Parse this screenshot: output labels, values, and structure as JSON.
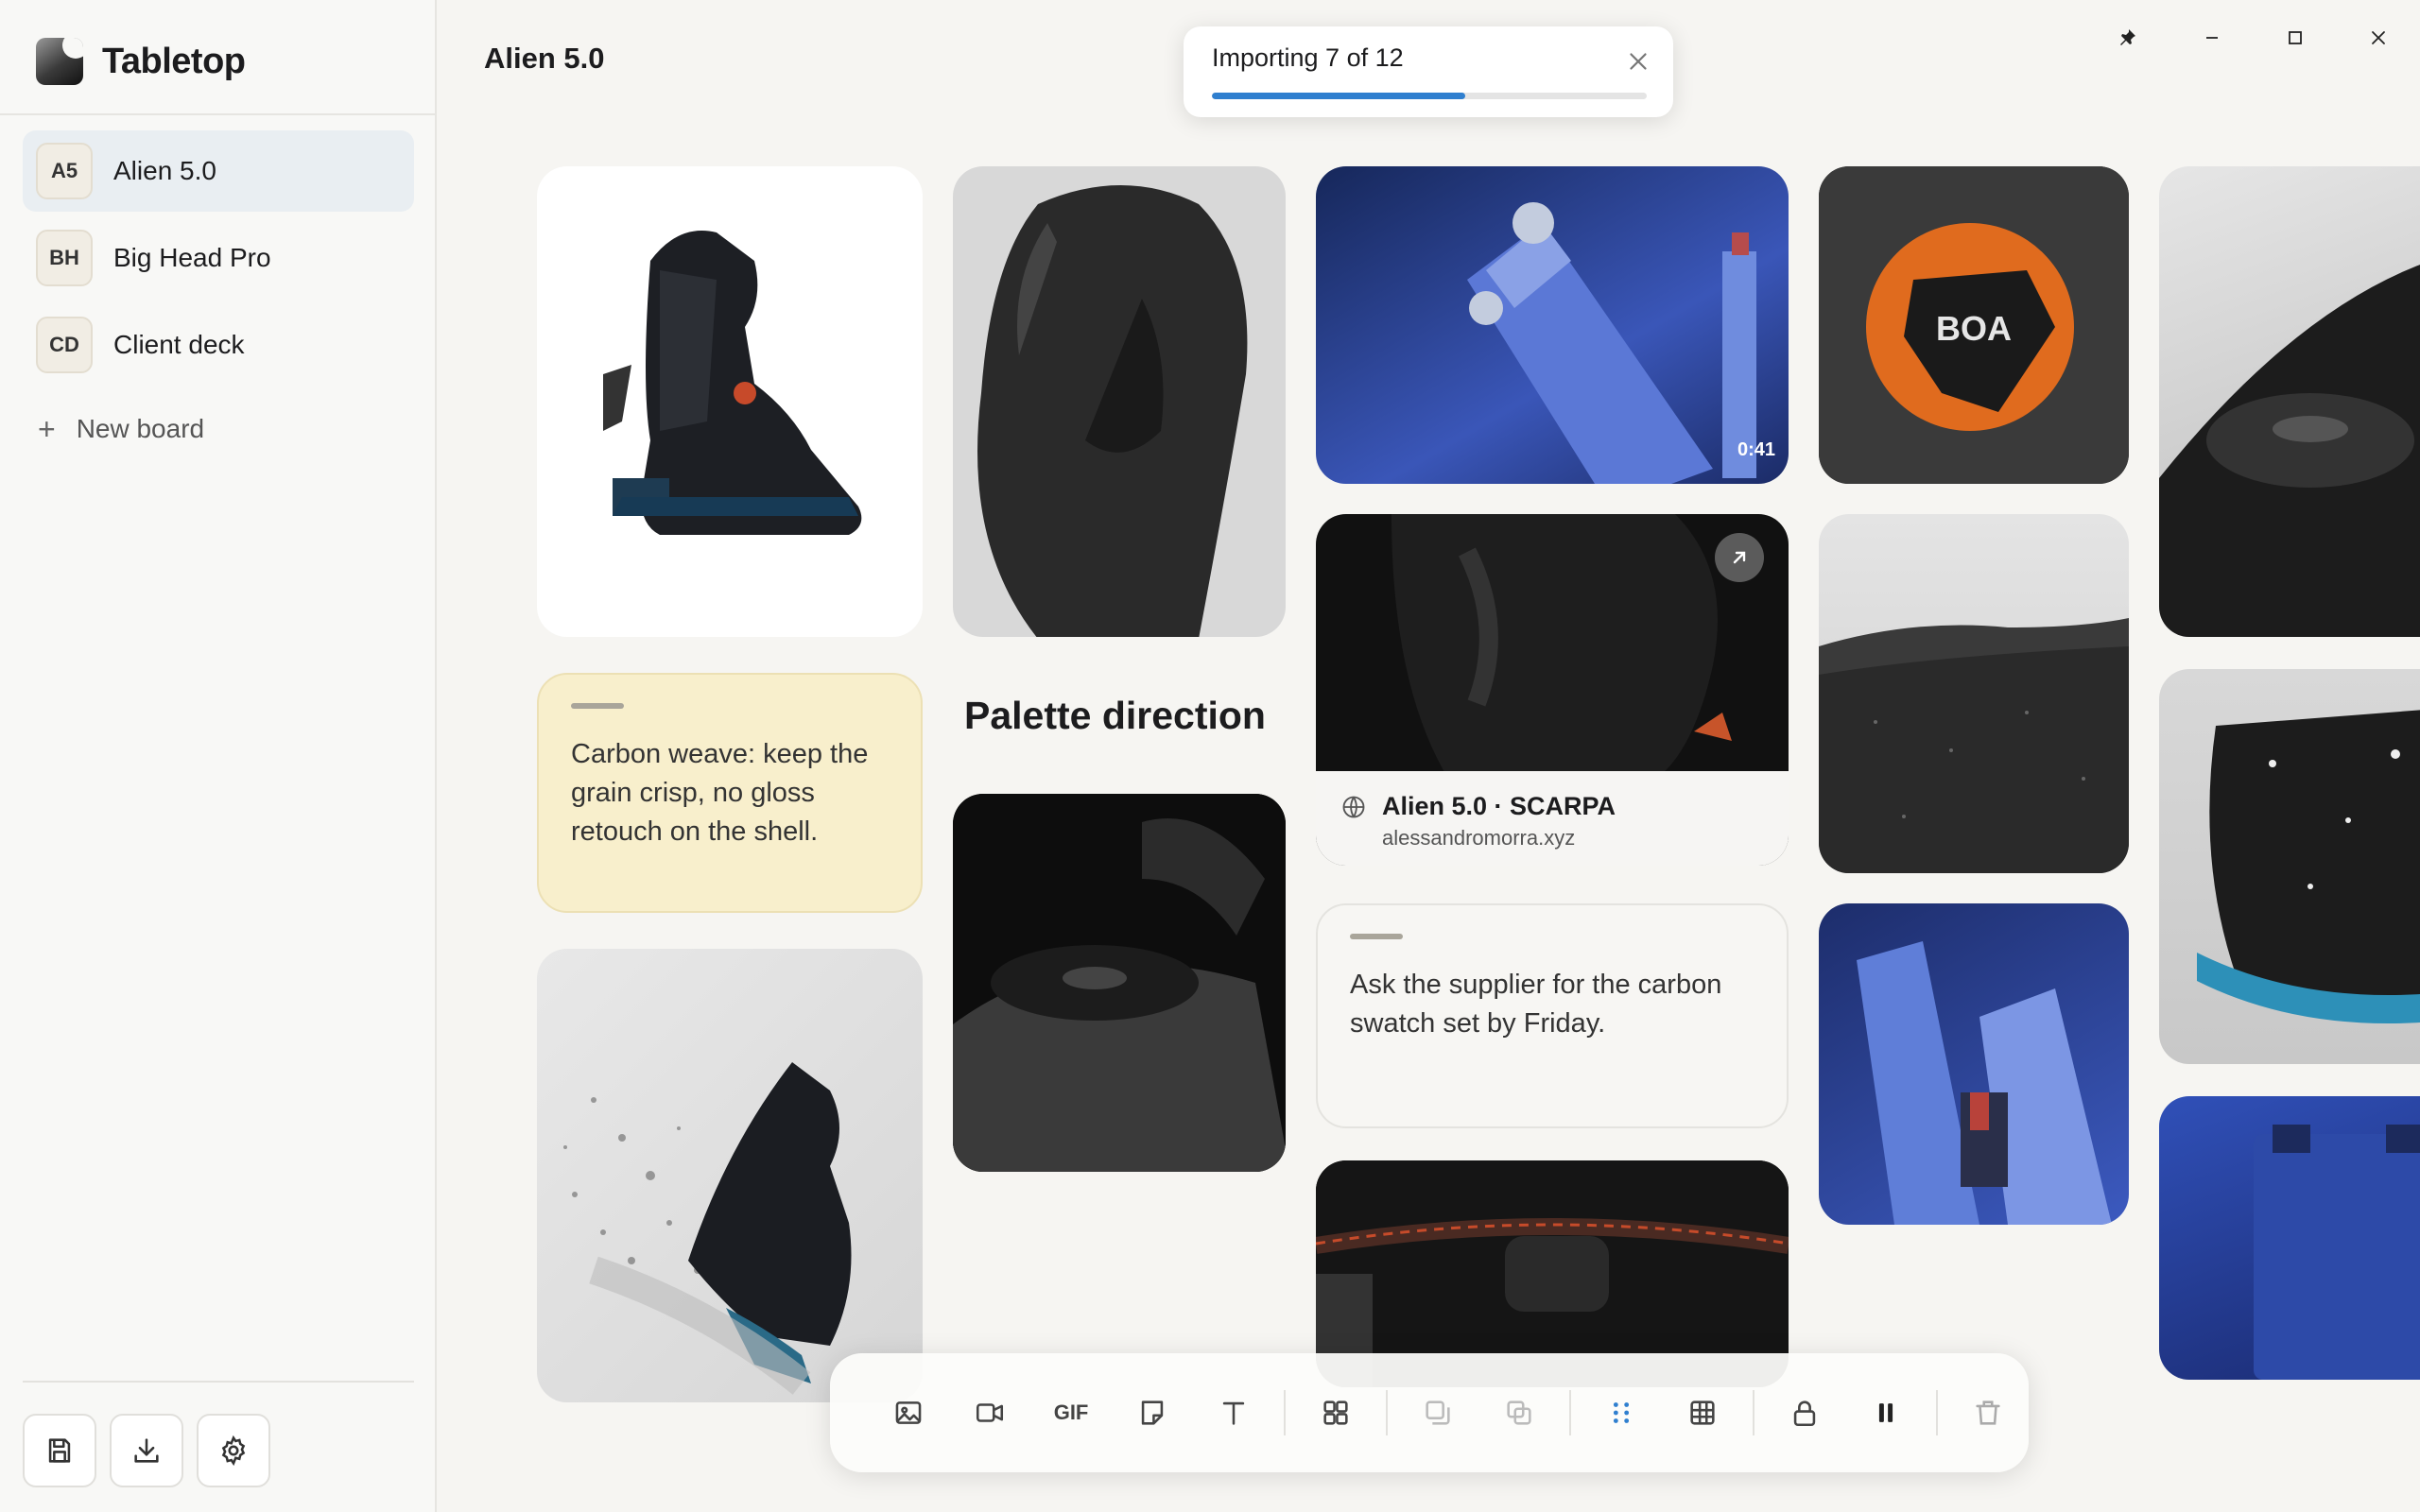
{
  "app": {
    "name": "Tabletop"
  },
  "sidebar": {
    "boards": [
      {
        "initials": "A5",
        "label": "Alien 5.0",
        "active": true
      },
      {
        "initials": "BH",
        "label": "Big Head Pro",
        "active": false
      },
      {
        "initials": "CD",
        "label": "Client deck",
        "active": false
      }
    ],
    "new_board": "New board",
    "actions": [
      "save-icon",
      "download-icon",
      "settings-icon"
    ]
  },
  "board": {
    "title": "Alien 5.0"
  },
  "toast": {
    "text": "Importing 7 of 12",
    "progress": 0.583
  },
  "window_controls": [
    "pin-icon",
    "minimize-icon",
    "maximize-icon",
    "close-icon"
  ],
  "canvas": {
    "note1": "Carbon weave: keep the grain crisp, no gloss retouch on the shell.",
    "heading": "Palette direction",
    "video_duration": "0:41",
    "link": {
      "title": "Alien 5.0 · SCARPA",
      "domain": "alessandromorra.xyz"
    },
    "note2": "Ask the supplier for the carbon swatch set by Friday.",
    "logo_text": "BOA",
    "note_color": "#f8efcc"
  },
  "toolbar": {
    "gif": "GIF"
  },
  "colors": {
    "accent": "#2f7fcf",
    "active_board": "#e9eef2"
  }
}
